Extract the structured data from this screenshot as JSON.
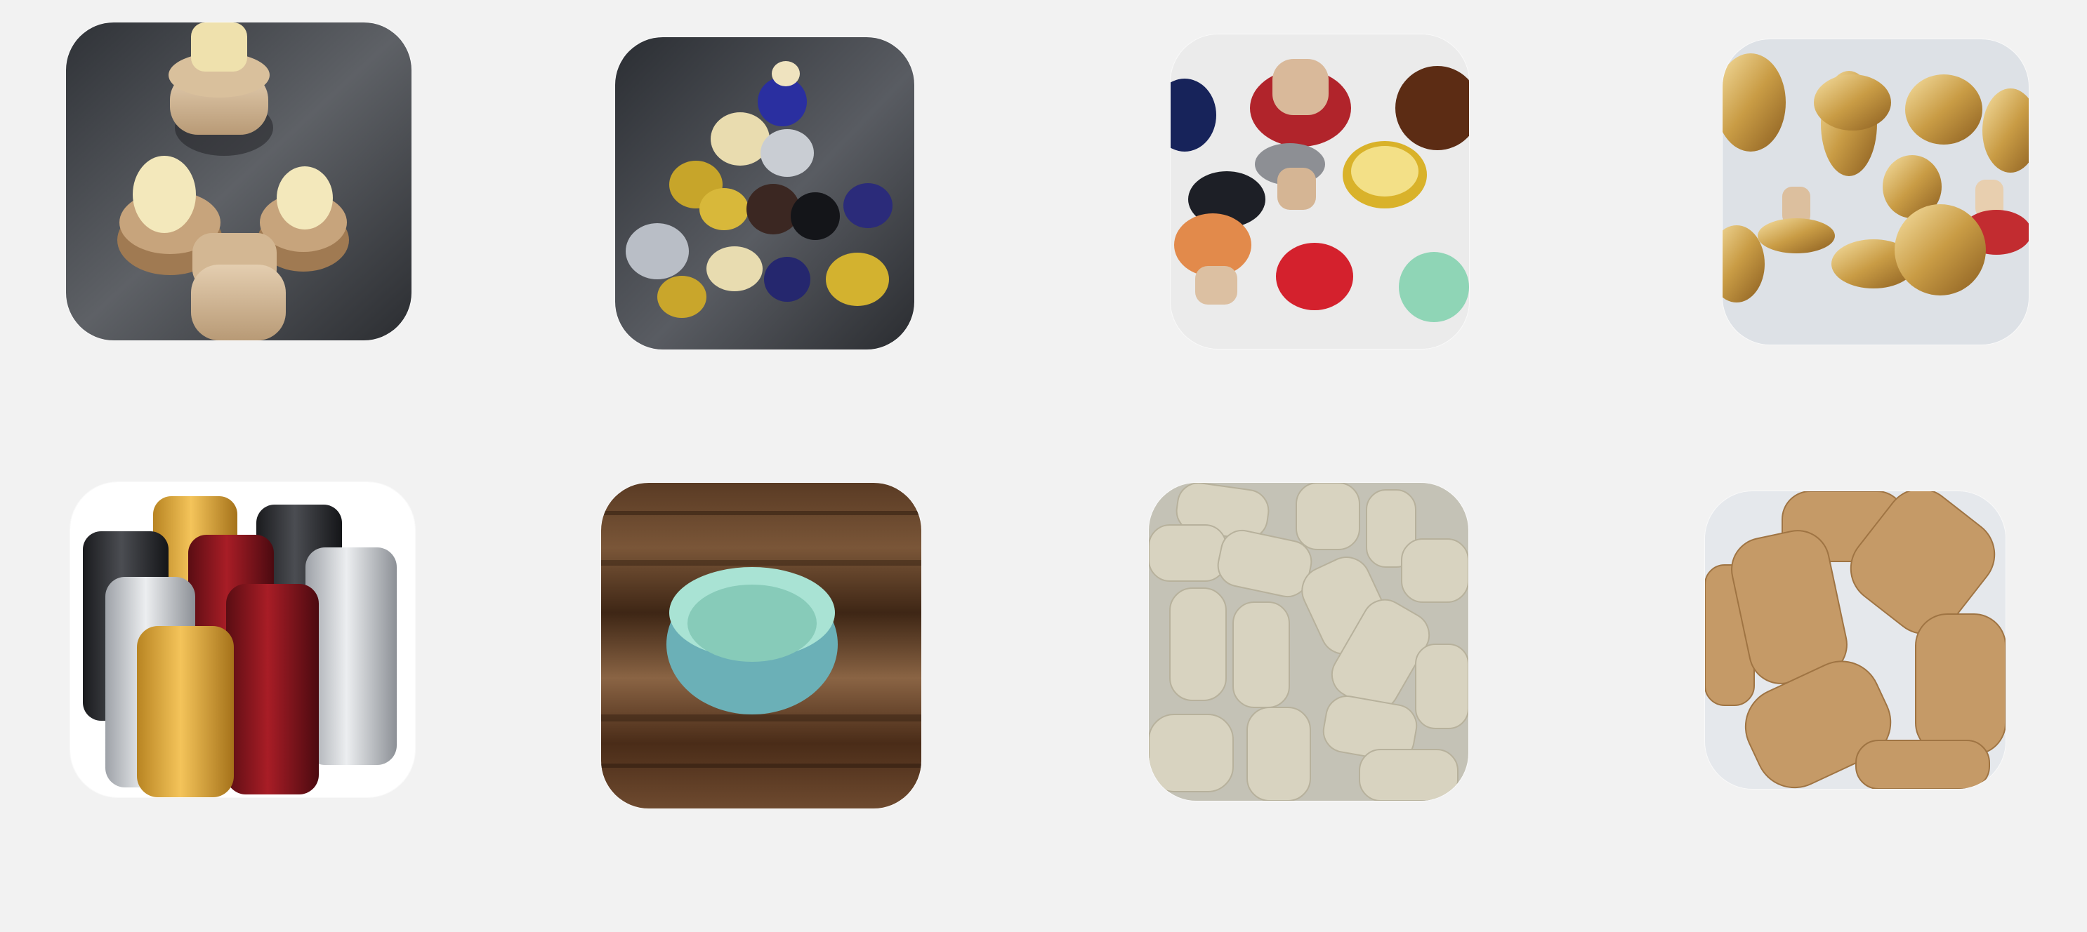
{
  "page": {
    "background": "#f2f2f2"
  },
  "gallery": {
    "tiles": [
      {
        "image": "wooden-t-top-corks",
        "backdrop": "#3a3d42"
      },
      {
        "image": "metal-cap-bar-top-stoppers",
        "backdrop": "#34373c"
      },
      {
        "image": "colored-cap-synthetic-corks",
        "backdrop": "#ececec"
      },
      {
        "image": "gold-zamak-decorative-stoppers",
        "backdrop": "#dfe3e8"
      },
      {
        "image": "aluminum-screw-caps",
        "backdrop": "#ffffff"
      },
      {
        "image": "mint-plastic-cap-on-wood",
        "backdrop": "#5a3b26"
      },
      {
        "image": "natural-cork-pile",
        "backdrop": "#c9c7bc"
      },
      {
        "image": "agglomerated-cork-stoppers",
        "backdrop": "#e6e8ec"
      }
    ]
  }
}
